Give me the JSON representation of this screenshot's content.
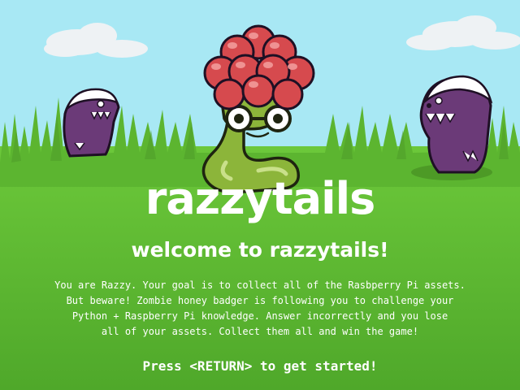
{
  "title_screen": {
    "logo_text": "razzytails",
    "welcome": "welcome to razzytails!",
    "intro_lines": [
      "You are Razzy. Your goal is to collect all of the Rasbperry Pi assets.",
      "But beware! Zombie honey badger is following you to challenge your",
      "Python + Raspberry Pi knowledge. Answer incorrectly and you lose",
      "all of your assets. Collect them all and win the game!"
    ],
    "start_prompt": "Press <RETURN> to get started!"
  },
  "characters": {
    "razzy": {
      "icon": "raspberry-snake-character",
      "head_color": "#d64a4e",
      "body_color": "#8cb53a"
    },
    "badger_left": {
      "icon": "zombie-honey-badger",
      "color": "#6b3a78"
    },
    "badger_right": {
      "icon": "zombie-honey-badger",
      "color": "#6b3a78"
    }
  },
  "colors": {
    "sky": "#a8e8f4",
    "grass": "#5cb530",
    "grass_dark": "#3f8e22",
    "text": "#ffffff"
  }
}
